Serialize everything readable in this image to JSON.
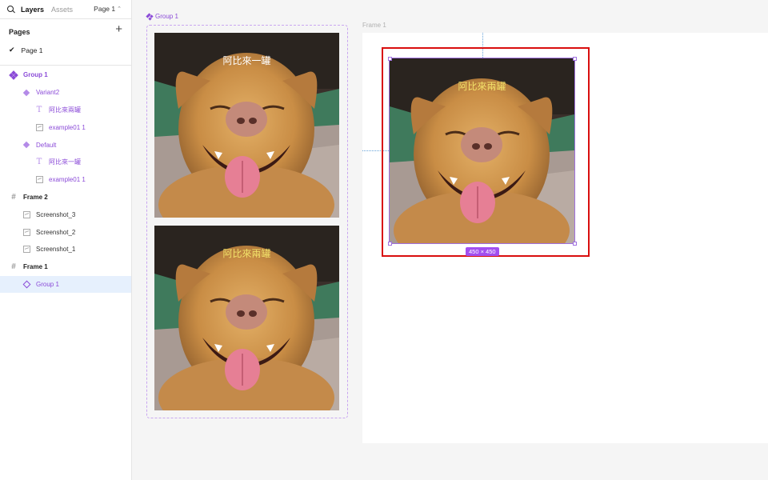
{
  "panel": {
    "tabs": {
      "layers": "Layers",
      "assets": "Assets"
    },
    "page_select": "Page 1",
    "pages_title": "Pages",
    "pages_add": "+",
    "pages": [
      {
        "label": "Page 1",
        "checked": true
      }
    ]
  },
  "layers": [
    {
      "label": "Group 1",
      "icon": "component-set-icon",
      "purple": true,
      "bold": true,
      "indent": 0
    },
    {
      "label": "Variant2",
      "icon": "variant-icon",
      "purple": true,
      "bold": false,
      "indent": 1
    },
    {
      "label": "阿比來兩罐",
      "icon": "text-icon",
      "purple": true,
      "bold": false,
      "indent": 2
    },
    {
      "label": "example01 1",
      "icon": "image-icon",
      "purple": true,
      "bold": false,
      "indent": 2
    },
    {
      "label": "Default",
      "icon": "variant-icon",
      "purple": true,
      "bold": false,
      "indent": 1
    },
    {
      "label": "阿比來一罐",
      "icon": "text-icon",
      "purple": true,
      "bold": false,
      "indent": 2
    },
    {
      "label": "example01 1",
      "icon": "image-icon",
      "purple": true,
      "bold": false,
      "indent": 2
    },
    {
      "label": "Frame 2",
      "icon": "frame-icon",
      "purple": false,
      "bold": true,
      "indent": 0
    },
    {
      "label": "Screenshot_3",
      "icon": "image-icon",
      "purple": false,
      "bold": false,
      "indent": 1
    },
    {
      "label": "Screenshot_2",
      "icon": "image-icon",
      "purple": false,
      "bold": false,
      "indent": 1
    },
    {
      "label": "Screenshot_1",
      "icon": "image-icon",
      "purple": false,
      "bold": false,
      "indent": 1
    },
    {
      "label": "Frame 1",
      "icon": "frame-icon",
      "purple": false,
      "bold": true,
      "indent": 0
    },
    {
      "label": "Group 1",
      "icon": "instance-icon",
      "purple": true,
      "bold": false,
      "indent": 1,
      "selected": true
    }
  ],
  "canvas": {
    "group_label": "Group 1",
    "frame_label": "Frame 1",
    "cards": [
      {
        "text": "阿比來一罐",
        "text_color": "white"
      },
      {
        "text": "阿比來兩罐",
        "text_color": "yellow"
      }
    ],
    "selected_card": {
      "text": "阿比來兩罐",
      "text_color": "yellow"
    },
    "size_badge": "450 × 450"
  },
  "colors": {
    "accent_purple": "#8b4bd8",
    "selection_red": "#d90e0e",
    "badge_purple": "#a24ff0",
    "text_yellow": "#f3e36a"
  }
}
